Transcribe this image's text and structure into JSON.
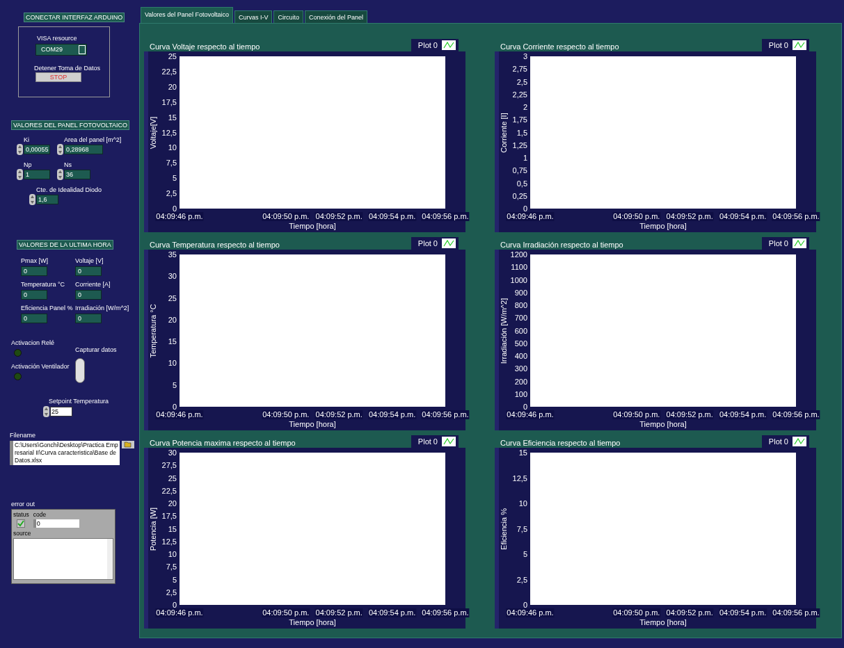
{
  "arduino": {
    "title": "CONECTAR INTERFAZ ARDUINO",
    "visa_label": "VISA resource",
    "visa_value": "COM29",
    "stop_label": "Detener Toma de Datos",
    "stop_button": "STOP"
  },
  "panel_values": {
    "title": "VALORES DEL PANEL FOTOVOLTAICO",
    "fields": [
      {
        "label": "Ki",
        "value": "0,00055"
      },
      {
        "label": "Area del panel [m^2]",
        "value": "0,28968"
      },
      {
        "label": "Np",
        "value": "1"
      },
      {
        "label": "Ns",
        "value": "36"
      },
      {
        "label": "Cte. de Idealidad Diodo",
        "value": "1,6"
      }
    ]
  },
  "last_hour": {
    "title": "VALORES DE LA ULTIMA HORA",
    "indicators": [
      {
        "label": "Pmax [W]",
        "value": "0"
      },
      {
        "label": "Voltaje [V]",
        "value": "0"
      },
      {
        "label": "Temperatura °C",
        "value": "0"
      },
      {
        "label": "Corriente [A]",
        "value": "0"
      },
      {
        "label": "Eficiencia Panel %",
        "value": "0"
      },
      {
        "label": "Irradiación [W/m^2]",
        "value": "0"
      }
    ]
  },
  "leds": [
    {
      "label": "Activacion Relé",
      "on": false
    },
    {
      "label": "Activación Ventilador",
      "on": false
    }
  ],
  "capture_toggle": {
    "label": "Capturar datos",
    "on": false
  },
  "setpoint": {
    "label": "Setpoint Temperatura",
    "value": "25"
  },
  "filename": {
    "label": "Filename",
    "value": "C:\\Users\\Gonchi\\Desktop\\Practica Empresarial II\\Curva caracteristica\\Base de Datos.xlsx"
  },
  "error_out": {
    "title": "error out",
    "status_label": "status",
    "status_ok": true,
    "code_label": "code",
    "code": "0",
    "source_label": "source"
  },
  "tabs": [
    {
      "label": "Valores del Panel Fotovoltaico",
      "selected": true
    },
    {
      "label": "Curvas I-V",
      "selected": false
    },
    {
      "label": "Circuito",
      "selected": false
    },
    {
      "label": "Conexión del Panel",
      "selected": false
    }
  ],
  "charts": [
    {
      "legend": "Plot 0",
      "chart_data": {
        "type": "line",
        "title": "Curva Voltaje respecto al tiempo",
        "xlabel": "Tiempo [hora]",
        "ylabel": "Voltaje[V]",
        "ylim": [
          0,
          25
        ],
        "yticks": [
          {
            "value": 0,
            "label": "0"
          },
          {
            "value": 2.5,
            "label": "2,5"
          },
          {
            "value": 5,
            "label": "5"
          },
          {
            "value": 7.5,
            "label": "7,5"
          },
          {
            "value": 10,
            "label": "10"
          },
          {
            "value": 12.5,
            "label": "12,5"
          },
          {
            "value": 15,
            "label": "15"
          },
          {
            "value": 17.5,
            "label": "17,5"
          },
          {
            "value": 20,
            "label": "20"
          },
          {
            "value": 22.5,
            "label": "22,5"
          },
          {
            "value": 25,
            "label": "25"
          }
        ],
        "categories": [
          "04:09:46 p.m.",
          null,
          "04:09:50 p.m.",
          "04:09:52 p.m.",
          "04:09:54 p.m.",
          "04:09:56 p.m."
        ]
      }
    },
    {
      "legend": "Plot 0",
      "chart_data": {
        "type": "line",
        "title": "Curva Corriente respecto al tiempo",
        "xlabel": "Tiempo [hora]",
        "ylabel": "Corriente [I]",
        "ylim": [
          0,
          3
        ],
        "yticks": [
          {
            "value": 0,
            "label": "0"
          },
          {
            "value": 0.25,
            "label": "0,25"
          },
          {
            "value": 0.5,
            "label": "0,5"
          },
          {
            "value": 0.75,
            "label": "0,75"
          },
          {
            "value": 1,
            "label": "1"
          },
          {
            "value": 1.25,
            "label": "1,25"
          },
          {
            "value": 1.5,
            "label": "1,5"
          },
          {
            "value": 1.75,
            "label": "1,75"
          },
          {
            "value": 2,
            "label": "2"
          },
          {
            "value": 2.25,
            "label": "2,25"
          },
          {
            "value": 2.5,
            "label": "2,5"
          },
          {
            "value": 2.75,
            "label": "2,75"
          },
          {
            "value": 3,
            "label": "3"
          }
        ],
        "categories": [
          "04:09:46 p.m.",
          null,
          "04:09:50 p.m.",
          "04:09:52 p.m.",
          "04:09:54 p.m.",
          "04:09:56 p.m."
        ]
      }
    },
    {
      "legend": "Plot 0",
      "chart_data": {
        "type": "line",
        "title": "Curva Temperatura respecto al tiempo",
        "xlabel": "Tiempo [hora]",
        "ylabel": "Temperatura °C",
        "ylim": [
          0,
          35
        ],
        "yticks": [
          {
            "value": 0,
            "label": "0"
          },
          {
            "value": 5,
            "label": "5"
          },
          {
            "value": 10,
            "label": "10"
          },
          {
            "value": 15,
            "label": "15"
          },
          {
            "value": 20,
            "label": "20"
          },
          {
            "value": 25,
            "label": "25"
          },
          {
            "value": 30,
            "label": "30"
          },
          {
            "value": 35,
            "label": "35"
          }
        ],
        "categories": [
          "04:09:46 p.m.",
          null,
          "04:09:50 p.m.",
          "04:09:52 p.m.",
          "04:09:54 p.m.",
          "04:09:56 p.m."
        ]
      }
    },
    {
      "legend": "Plot 0",
      "chart_data": {
        "type": "line",
        "title": "Curva Irradiación respecto al tiempo",
        "xlabel": "Tiempo [hora]",
        "ylabel": "Irradiación [W/m^2]",
        "ylim": [
          0,
          1200
        ],
        "yticks": [
          {
            "value": 0,
            "label": "0"
          },
          {
            "value": 100,
            "label": "100"
          },
          {
            "value": 200,
            "label": "200"
          },
          {
            "value": 300,
            "label": "300"
          },
          {
            "value": 400,
            "label": "400"
          },
          {
            "value": 500,
            "label": "500"
          },
          {
            "value": 600,
            "label": "600"
          },
          {
            "value": 700,
            "label": "700"
          },
          {
            "value": 800,
            "label": "800"
          },
          {
            "value": 900,
            "label": "900"
          },
          {
            "value": 1000,
            "label": "1000"
          },
          {
            "value": 1100,
            "label": "1100"
          },
          {
            "value": 1200,
            "label": "1200"
          }
        ],
        "categories": [
          "04:09:46 p.m.",
          null,
          "04:09:50 p.m.",
          "04:09:52 p.m.",
          "04:09:54 p.m.",
          "04:09:56 p.m."
        ]
      }
    },
    {
      "legend": "Plot 0",
      "chart_data": {
        "type": "line",
        "title": "Curva Potencia maxima respecto al tiempo",
        "xlabel": "Tiempo [hora]",
        "ylabel": "Potencia [W]",
        "ylim": [
          0,
          30
        ],
        "yticks": [
          {
            "value": 0,
            "label": "0"
          },
          {
            "value": 2.5,
            "label": "2,5"
          },
          {
            "value": 5,
            "label": "5"
          },
          {
            "value": 7.5,
            "label": "7,5"
          },
          {
            "value": 10,
            "label": "10"
          },
          {
            "value": 12.5,
            "label": "12,5"
          },
          {
            "value": 15,
            "label": "15"
          },
          {
            "value": 17.5,
            "label": "17,5"
          },
          {
            "value": 20,
            "label": "20"
          },
          {
            "value": 22.5,
            "label": "22,5"
          },
          {
            "value": 25,
            "label": "25"
          },
          {
            "value": 27.5,
            "label": "27,5"
          },
          {
            "value": 30,
            "label": "30"
          }
        ],
        "categories": [
          "04:09:46 p.m.",
          null,
          "04:09:50 p.m.",
          "04:09:52 p.m.",
          "04:09:54 p.m.",
          "04:09:56 p.m."
        ]
      }
    },
    {
      "legend": "Plot 0",
      "chart_data": {
        "type": "line",
        "title": "Curva Eficiencia respecto al tiempo",
        "xlabel": "Tiempo [hora]",
        "ylabel": "Eficiencia %",
        "ylim": [
          0,
          15
        ],
        "yticks": [
          {
            "value": 0,
            "label": "0"
          },
          {
            "value": 2.5,
            "label": "2,5"
          },
          {
            "value": 5,
            "label": "5"
          },
          {
            "value": 7.5,
            "label": "7,5"
          },
          {
            "value": 10,
            "label": "10"
          },
          {
            "value": 12.5,
            "label": "12,5"
          },
          {
            "value": 15,
            "label": "15"
          }
        ],
        "categories": [
          "04:09:46 p.m.",
          null,
          "04:09:50 p.m.",
          "04:09:52 p.m.",
          "04:09:54 p.m.",
          "04:09:56 p.m."
        ]
      }
    }
  ]
}
